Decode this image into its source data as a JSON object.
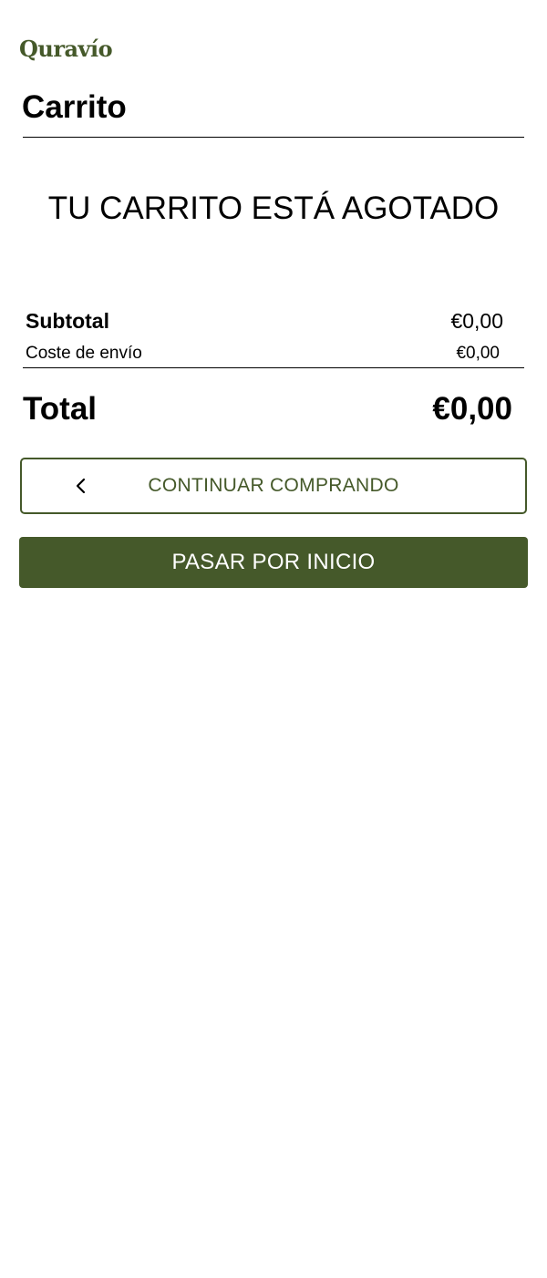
{
  "brand": {
    "logo_text": "Quravío",
    "accent_color": "#45592a"
  },
  "page": {
    "title": "Carrito",
    "empty_message": "TU CARRITO ESTÁ AGOTADO"
  },
  "summary": {
    "subtotal_label": "Subtotal",
    "subtotal_value": "€0,00",
    "shipping_label": "Coste de envío",
    "shipping_value": "€0,00",
    "total_label": "Total",
    "total_value": "€0,00"
  },
  "actions": {
    "continue_label": "CONTINUAR COMPRANDO",
    "continue_icon": "chevron-left-icon",
    "home_label": "PASAR POR INICIO"
  }
}
